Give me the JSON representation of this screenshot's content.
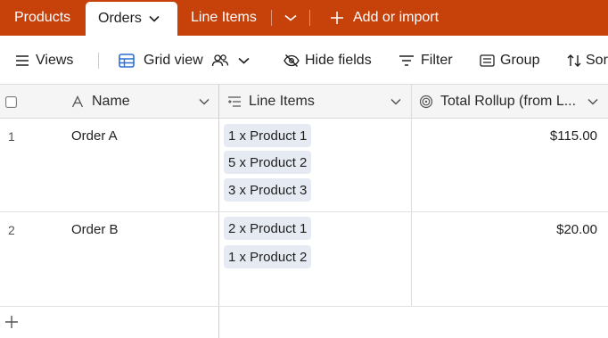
{
  "tabs": {
    "products": "Products",
    "orders": "Orders",
    "line_items": "Line Items",
    "add_or_import": "Add or import"
  },
  "toolbar": {
    "views": "Views",
    "grid_view": "Grid view",
    "hide_fields": "Hide fields",
    "filter": "Filter",
    "group": "Group",
    "sort": "Sor"
  },
  "columns": {
    "name": "Name",
    "line_items": "Line Items",
    "total_rollup": "Total Rollup (from L..."
  },
  "rows": [
    {
      "number": "1",
      "name": "Order A",
      "line_items": [
        "1 x Product 1",
        "5 x Product 2",
        "3 x Product 3"
      ],
      "total": "$115.00"
    },
    {
      "number": "2",
      "name": "Order B",
      "line_items": [
        "2 x Product 1",
        "1 x Product 2"
      ],
      "total": "$20.00"
    }
  ],
  "colors": {
    "tab_bar": "#c7420b",
    "pill_background": "#e6ebf3",
    "header_background": "#f5f5f5"
  }
}
